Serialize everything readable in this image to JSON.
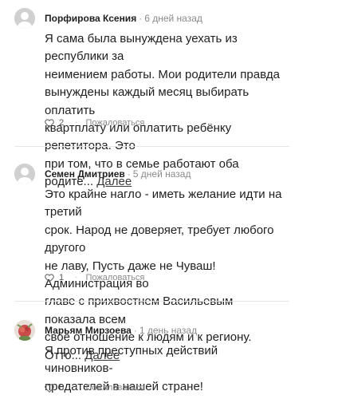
{
  "comments": [
    {
      "author": "Порфирова Ксения",
      "time": "6 дней назад",
      "text_lines": [
        "Я сама была вынуждена уехать из республики за",
        "неимением работы. Мои родители правда",
        "вынуждены каждый месяц выбирать оплатить",
        "квартплату или оплатить ребёнку репетитора. Это",
        "при том, что в семье работают оба родите..."
      ],
      "more_label": "Далее",
      "likes": "2",
      "report_label": "Пожаловаться"
    },
    {
      "author": "Семен Дмитриев",
      "time": "5 дней назад",
      "text_lines": [
        "Это крайне нагло - иметь желание идти на третий",
        "срок. Народ не доверяет, требует любого другого",
        "не лаву, Пусть даже не Чуваш! Администрация во",
        "главе с прихвостнем Васильевым показала всем",
        "своё отношение к людям и к региону. Отто..."
      ],
      "more_label": "Далее",
      "likes": "1",
      "report_label": "Пожаловаться"
    },
    {
      "author": "Марьям Мирзоева",
      "time": "1 день назад",
      "text_lines": [
        "Я против преступных действий чиновников-",
        "предателей в нашей стране!"
      ],
      "likes": "0",
      "report_label": "Пожаловаться"
    }
  ],
  "separator": "·",
  "colors": {
    "avatar_placeholder": "#cfcfcf",
    "avatar_photo": "#c94b4b",
    "divider": "#e6e6e6"
  }
}
